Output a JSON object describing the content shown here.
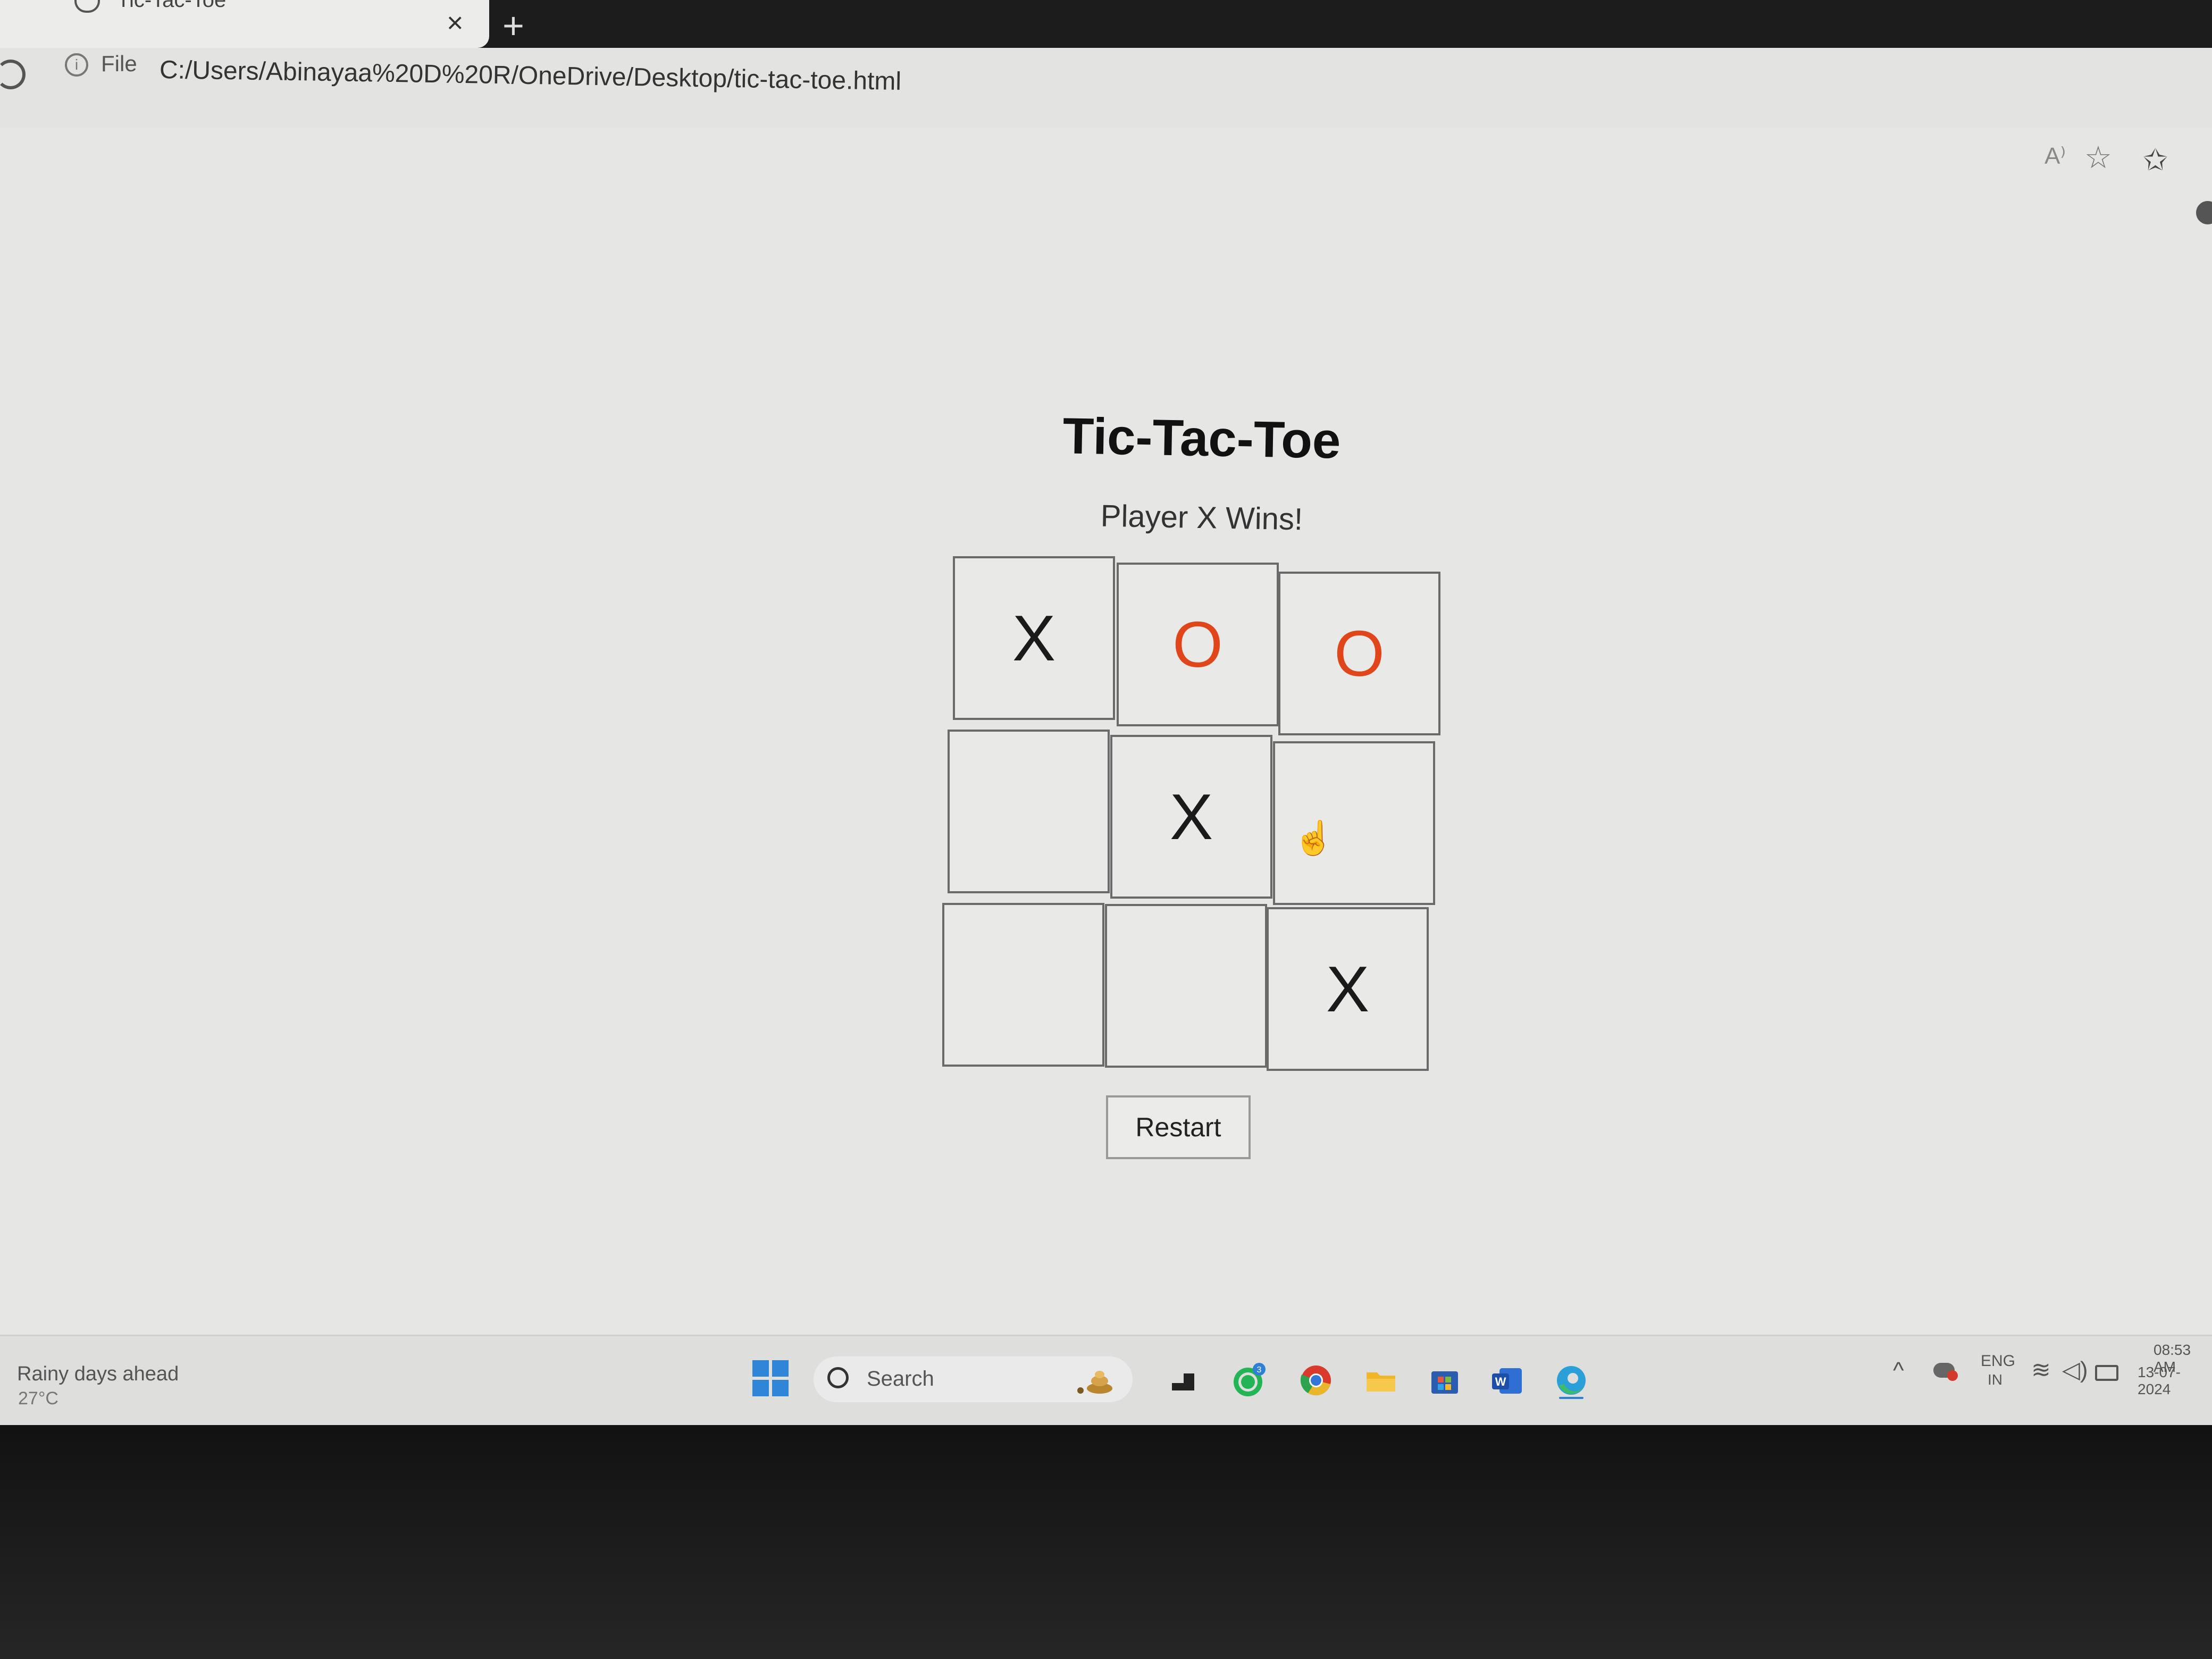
{
  "browser": {
    "tab_title": "Tic-Tac-Toe",
    "close_glyph": "×",
    "new_tab_glyph": "+",
    "info_glyph": "i",
    "file_label": "File",
    "url": "C:/Users/Abinayaa%20D%20R/OneDrive/Desktop/tic-tac-toe.html",
    "read_aloud_glyph": "A⁾",
    "favorite_glyph": "☆",
    "favorites_bar_glyph": "✩"
  },
  "page": {
    "title": "Tic-Tac-Toe",
    "status": "Player X Wins!",
    "board": [
      "X",
      "O",
      "O",
      "",
      "X",
      "",
      "",
      "",
      "X"
    ],
    "restart_label": "Restart",
    "colors": {
      "x": "#1a1a1a",
      "o": "#e0461a"
    }
  },
  "taskbar": {
    "weather_text": "Rainy days ahead",
    "weather_temp": "27°C",
    "search_placeholder": "Search",
    "apps": [
      "task-view",
      "whatsapp",
      "chrome",
      "file-explorer",
      "microsoft-store",
      "word",
      "edge"
    ],
    "whatsapp_badge": "3",
    "tray": {
      "chevron": "^",
      "lang_line1": "ENG",
      "lang_line2": "IN",
      "wifi_glyph": "≋",
      "volume_glyph": "◁)",
      "time": "08:53 AM",
      "date": "13-07-2024"
    }
  }
}
